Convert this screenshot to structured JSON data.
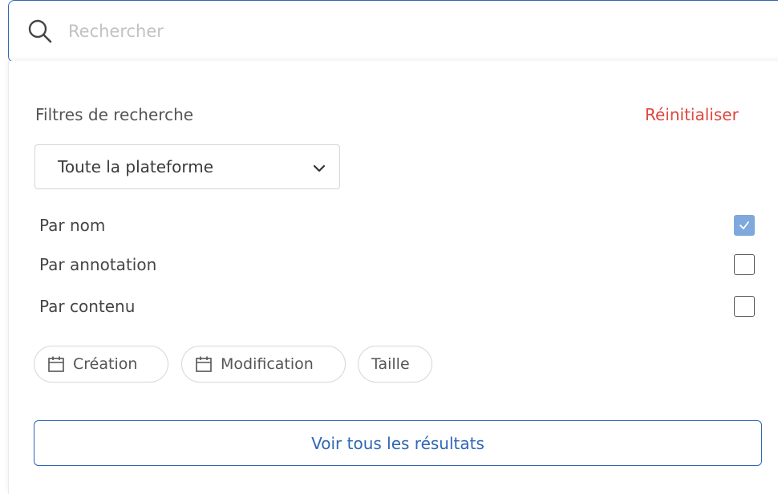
{
  "search": {
    "placeholder": "Rechercher",
    "value": "",
    "icon": "search-icon"
  },
  "filters": {
    "title": "Filtres de recherche",
    "reset_label": "Réinitialiser",
    "scope": {
      "selected": "Toute la plateforme",
      "icon": "chevron-down-icon"
    },
    "options": [
      {
        "label": "Par nom",
        "checked": true
      },
      {
        "label": "Par annotation",
        "checked": false
      },
      {
        "label": "Par contenu",
        "checked": false
      }
    ],
    "chips": [
      {
        "label": "Création",
        "icon": "calendar-icon"
      },
      {
        "label": "Modification",
        "icon": "calendar-icon"
      },
      {
        "label": "Taille",
        "icon": ""
      }
    ]
  },
  "results_button_label": "Voir tous les résultats",
  "colors": {
    "accent": "#2f67b5",
    "reset": "#e0463e",
    "checkbox_checked": "#7fa8dc"
  }
}
